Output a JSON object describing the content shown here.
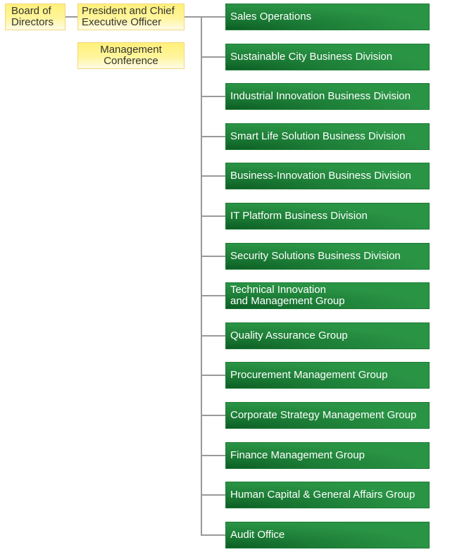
{
  "board": "Board of\nDirectors",
  "president": "President and Chief\nExecutive Officer",
  "conference": "Management\nConference",
  "units": [
    "Sales Operations",
    "Sustainable City Business Division",
    "Industrial Innovation Business Division",
    "Smart Life Solution Business Division",
    "Business-Innovation Business Division",
    "IT Platform Business Division",
    "Security Solutions Business Division",
    "Technical Innovation\nand Management Group",
    "Quality Assurance Group",
    "Procurement Management Group",
    "Corporate Strategy Management Group",
    "Finance Management Group",
    "Human Capital & General Affairs Group",
    "Audit Office"
  ],
  "colors": {
    "unit_green": "#23883d",
    "exec_yellow": "#fff07a",
    "connector": "#999999"
  }
}
